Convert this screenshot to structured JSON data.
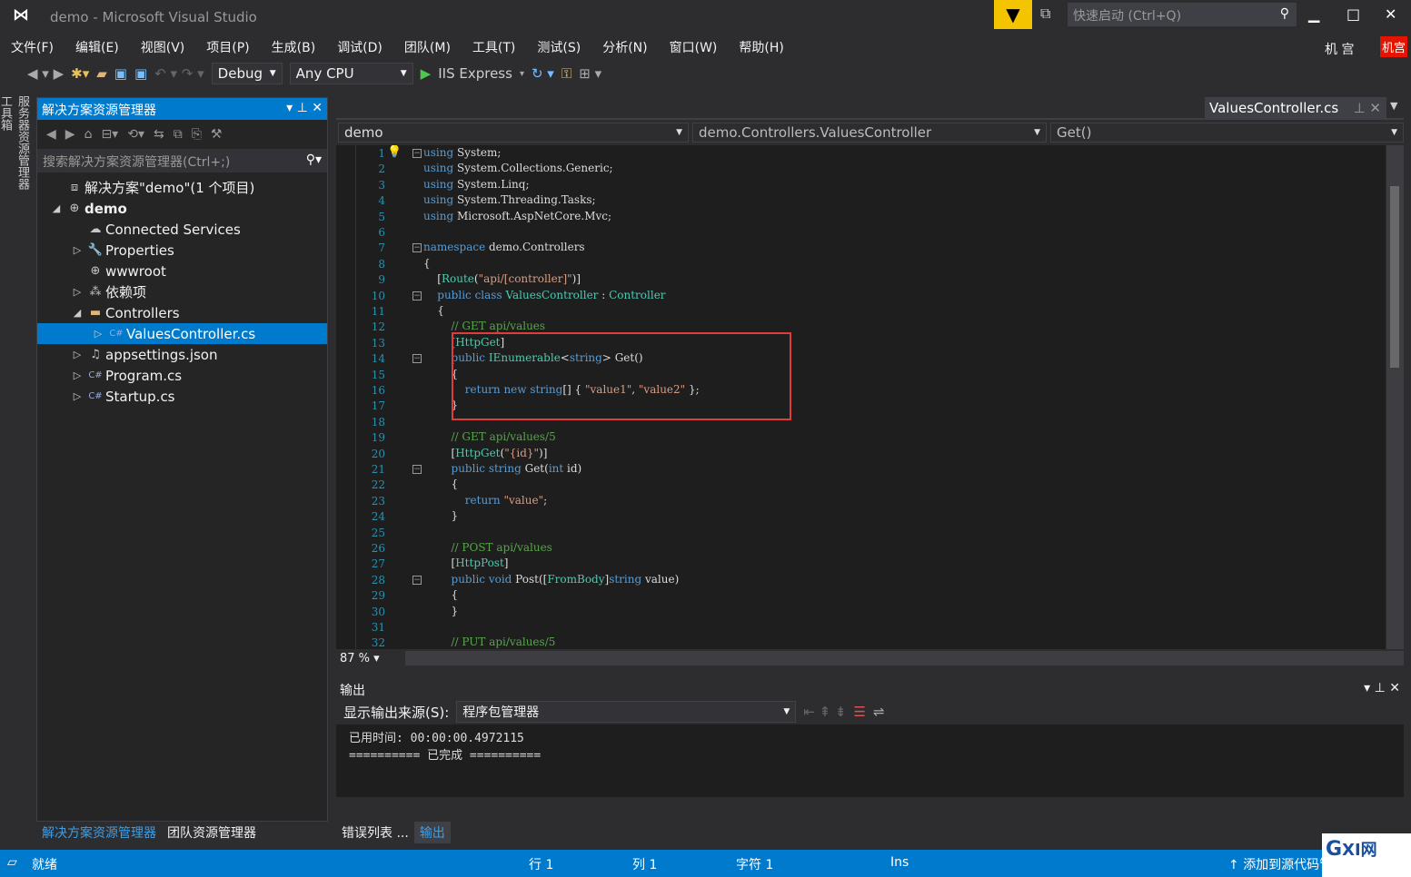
{
  "title": "demo - Microsoft Visual Studio",
  "quick_launch": "快速启动 (Ctrl+Q)",
  "user": {
    "name": "机 宫",
    "badge": "机宫"
  },
  "menu": [
    "文件(F)",
    "编辑(E)",
    "视图(V)",
    "项目(P)",
    "生成(B)",
    "调试(D)",
    "团队(M)",
    "工具(T)",
    "测试(S)",
    "分析(N)",
    "窗口(W)",
    "帮助(H)"
  ],
  "toolbar": {
    "config": "Debug",
    "platform": "Any CPU",
    "run": "IIS Express"
  },
  "vertical_tabs": [
    "服务器资源管理器",
    "工具箱"
  ],
  "solution_explorer": {
    "title": "解决方案资源管理器",
    "search_placeholder": "搜索解决方案资源管理器(Ctrl+;)",
    "items": [
      {
        "label": "解决方案\"demo\"(1 个项目)",
        "icon": "solution-icon",
        "depth": 0,
        "arrow": ""
      },
      {
        "label": "demo",
        "icon": "web-project-icon",
        "depth": 0,
        "arrow": "◢",
        "bold": true
      },
      {
        "label": "Connected Services",
        "icon": "cloud-icon",
        "depth": 1,
        "arrow": ""
      },
      {
        "label": "Properties",
        "icon": "wrench-icon",
        "depth": 1,
        "arrow": "▷"
      },
      {
        "label": "wwwroot",
        "icon": "globe-icon",
        "depth": 1,
        "arrow": ""
      },
      {
        "label": "依赖项",
        "icon": "dependencies-icon",
        "depth": 1,
        "arrow": "▷"
      },
      {
        "label": "Controllers",
        "icon": "folder-icon",
        "depth": 1,
        "arrow": "◢"
      },
      {
        "label": "ValuesController.cs",
        "icon": "csharp-file-icon",
        "depth": 2,
        "arrow": "▷",
        "selected": true
      },
      {
        "label": "appsettings.json",
        "icon": "json-file-icon",
        "depth": 1,
        "arrow": "▷"
      },
      {
        "label": "Program.cs",
        "icon": "csharp-file-icon",
        "depth": 1,
        "arrow": "▷"
      },
      {
        "label": "Startup.cs",
        "icon": "csharp-file-icon",
        "depth": 1,
        "arrow": "▷"
      }
    ],
    "bottom_tabs": [
      "解决方案资源管理器",
      "团队资源管理器"
    ]
  },
  "editor": {
    "tab": "ValuesController.cs",
    "nav": [
      "demo",
      "demo.Controllers.ValuesController",
      "Get()"
    ],
    "zoom": "87 %",
    "lines": [
      [
        [
          "using",
          "k"
        ],
        [
          " System;",
          ""
        ]
      ],
      [
        [
          "using",
          "k"
        ],
        [
          " System.Collections.Generic;",
          ""
        ]
      ],
      [
        [
          "using",
          "k"
        ],
        [
          " System.Linq;",
          ""
        ]
      ],
      [
        [
          "using",
          "k"
        ],
        [
          " System.Threading.Tasks;",
          ""
        ]
      ],
      [
        [
          "using",
          "k"
        ],
        [
          " Microsoft.AspNetCore.Mvc;",
          ""
        ]
      ],
      [],
      [
        [
          "namespace",
          "k"
        ],
        [
          " demo.Controllers",
          ""
        ]
      ],
      [
        [
          "{",
          ""
        ]
      ],
      [
        [
          "    [",
          ""
        ],
        [
          "Route",
          "t"
        ],
        [
          "(",
          ""
        ],
        [
          "\"api/[controller]\"",
          "s"
        ],
        [
          ")]",
          ""
        ]
      ],
      [
        [
          "    ",
          ""
        ],
        [
          "public class",
          "k"
        ],
        [
          " ",
          ""
        ],
        [
          "ValuesController",
          "t"
        ],
        [
          " : ",
          ""
        ],
        [
          "Controller",
          "t"
        ]
      ],
      [
        [
          "    {",
          ""
        ]
      ],
      [
        [
          "        ",
          ""
        ],
        [
          "// GET api/values",
          "c"
        ]
      ],
      [
        [
          "        [",
          ""
        ],
        [
          "HttpGet",
          "t"
        ],
        [
          "]",
          ""
        ]
      ],
      [
        [
          "        ",
          ""
        ],
        [
          "public",
          "k"
        ],
        [
          " ",
          ""
        ],
        [
          "IEnumerable",
          "t"
        ],
        [
          "<",
          ""
        ],
        [
          "string",
          "k"
        ],
        [
          "> Get()",
          ""
        ]
      ],
      [
        [
          "        {",
          ""
        ]
      ],
      [
        [
          "            ",
          ""
        ],
        [
          "return new string",
          "k"
        ],
        [
          "[] { ",
          ""
        ],
        [
          "\"value1\"",
          "s"
        ],
        [
          ", ",
          ""
        ],
        [
          "\"value2\"",
          "s"
        ],
        [
          " };",
          ""
        ]
      ],
      [
        [
          "        }",
          ""
        ]
      ],
      [],
      [
        [
          "        ",
          ""
        ],
        [
          "// GET api/values/5",
          "c"
        ]
      ],
      [
        [
          "        [",
          ""
        ],
        [
          "HttpGet",
          "t"
        ],
        [
          "(",
          ""
        ],
        [
          "\"{id}\"",
          "s"
        ],
        [
          ")]",
          ""
        ]
      ],
      [
        [
          "        ",
          ""
        ],
        [
          "public string",
          "k"
        ],
        [
          " Get(",
          ""
        ],
        [
          "int",
          "k"
        ],
        [
          " id)",
          ""
        ]
      ],
      [
        [
          "        {",
          ""
        ]
      ],
      [
        [
          "            ",
          ""
        ],
        [
          "return",
          "k"
        ],
        [
          " ",
          ""
        ],
        [
          "\"value\"",
          "s"
        ],
        [
          ";",
          ""
        ]
      ],
      [
        [
          "        }",
          ""
        ]
      ],
      [],
      [
        [
          "        ",
          ""
        ],
        [
          "// POST api/values",
          "c"
        ]
      ],
      [
        [
          "        [",
          ""
        ],
        [
          "HttpPost",
          "t"
        ],
        [
          "]",
          ""
        ]
      ],
      [
        [
          "        ",
          ""
        ],
        [
          "public void",
          "k"
        ],
        [
          " Post([",
          ""
        ],
        [
          "FromBody",
          "t"
        ],
        [
          "]",
          ""
        ],
        [
          "string",
          "k"
        ],
        [
          " value)",
          ""
        ]
      ],
      [
        [
          "        {",
          ""
        ]
      ],
      [
        [
          "        }",
          ""
        ]
      ],
      [],
      [
        [
          "        ",
          ""
        ],
        [
          "// PUT api/values/5",
          "c"
        ]
      ]
    ],
    "folds": [
      1,
      7,
      10,
      14,
      21,
      28
    ]
  },
  "output": {
    "title": "输出",
    "source_label": "显示输出来源(S):",
    "source": "程序包管理器",
    "text": "已用时间: 00:00:00.4972115\n========== 已完成 ==========",
    "tabs": [
      "错误列表 ...",
      "输出"
    ]
  },
  "status": {
    "ready": "就绪",
    "line": "行 1",
    "col": "列 1",
    "char": "字符 1",
    "mode": "Ins",
    "publish": "添加到源代码管理"
  },
  "watermark": "GXI网",
  "colors": {
    "accent": "#007acc",
    "highlight_box": "#e03c3c"
  }
}
